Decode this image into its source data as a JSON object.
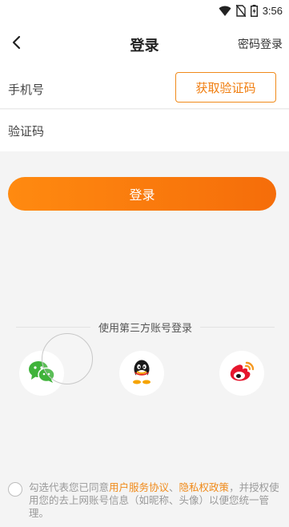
{
  "status_bar": {
    "time": "3:56",
    "icons": [
      "wifi-icon",
      "no-sim-icon",
      "battery-charging-icon"
    ]
  },
  "nav": {
    "back_icon": "chevron-left-icon",
    "title": "登录",
    "password_login": "密码登录"
  },
  "form": {
    "phone_label": "手机号",
    "phone_value": "",
    "get_code_button": "获取验证码",
    "code_label": "验证码",
    "code_value": ""
  },
  "login_button": "登录",
  "third_party": {
    "title": "使用第三方账号登录",
    "providers": [
      {
        "name": "wechat",
        "icon": "wechat-icon",
        "color": "#3fb33a"
      },
      {
        "name": "qq",
        "icon": "qq-icon",
        "color": "#1a1a1a"
      },
      {
        "name": "weibo",
        "icon": "weibo-icon",
        "color": "#e6162d"
      }
    ]
  },
  "agreement": {
    "checked": false,
    "prefix": "勾选代表您已同意",
    "user_agreement": "用户服务协议",
    "separator": "、",
    "privacy_policy": "隐私权政策",
    "suffix": "，并授权使用您的去上网账号信息（如昵称、头像）以便您统一管理。"
  },
  "colors": {
    "accent": "#f07d0e",
    "page_background": "#f4f4f4"
  }
}
